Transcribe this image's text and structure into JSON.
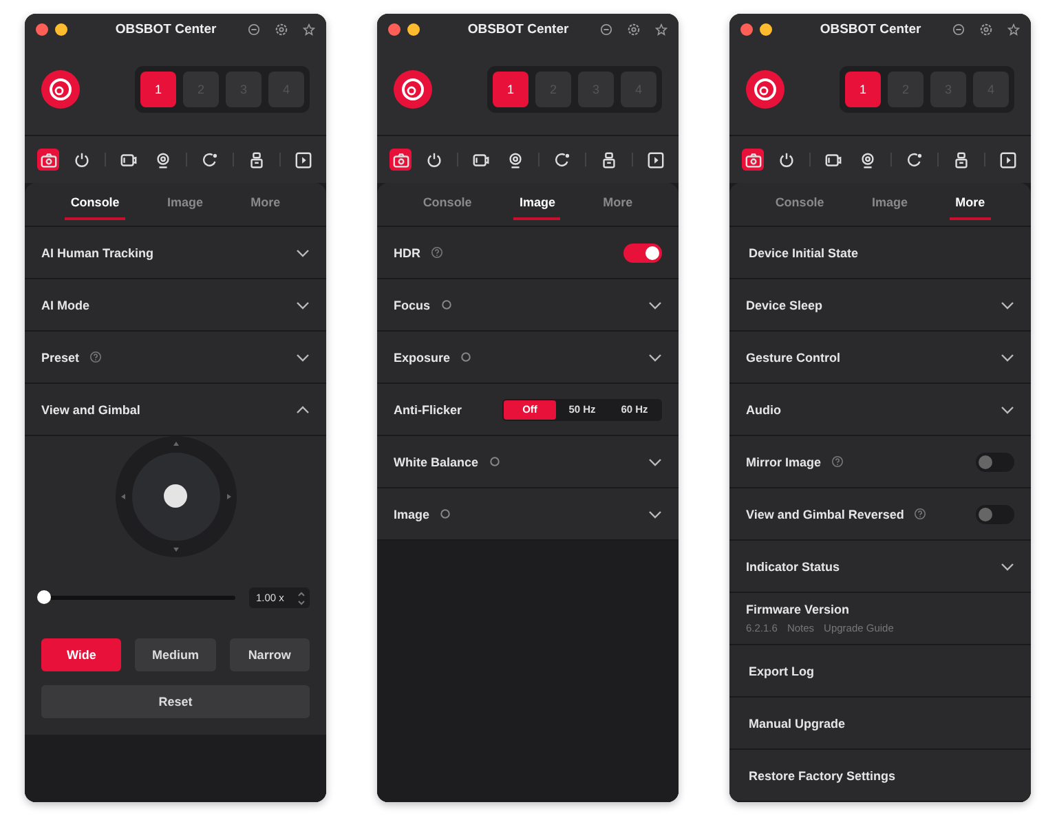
{
  "windows": [
    {
      "title": "OBSBOT Center",
      "devices": [
        {
          "label": "1",
          "selected": true
        },
        {
          "label": "2",
          "selected": false
        },
        {
          "label": "3",
          "selected": false
        },
        {
          "label": "4",
          "selected": false
        }
      ],
      "tools": [
        {
          "kind": "camera",
          "selected": true
        },
        {
          "kind": "power",
          "selected": false
        },
        {
          "kind": "sep"
        },
        {
          "kind": "recorder",
          "selected": false
        },
        {
          "kind": "webcam",
          "selected": false
        },
        {
          "kind": "sep"
        },
        {
          "kind": "rotate",
          "selected": false
        },
        {
          "kind": "sep"
        },
        {
          "kind": "usb",
          "selected": false
        },
        {
          "kind": "sep"
        },
        {
          "kind": "play",
          "selected": false
        }
      ],
      "tabs": [
        {
          "label": "Console",
          "selected": true
        },
        {
          "label": "Image",
          "selected": false
        },
        {
          "label": "More",
          "selected": false
        }
      ],
      "rows": [
        {
          "kind": "expand",
          "label": "AI Human Tracking",
          "expanded": false
        },
        {
          "kind": "expand",
          "label": "AI Mode",
          "expanded": false
        },
        {
          "kind": "expand",
          "label": "Preset",
          "help": true,
          "expanded": false
        },
        {
          "kind": "expand",
          "label": "View and Gimbal",
          "expanded": true,
          "gimbal": {
            "level": 0,
            "zoom_value": "1.00 x",
            "fov": [
              {
                "label": "Wide",
                "selected": true
              },
              {
                "label": "Medium",
                "selected": false
              },
              {
                "label": "Narrow",
                "selected": false
              }
            ],
            "reset": "Reset"
          }
        }
      ]
    },
    {
      "title": "OBSBOT Center",
      "devices": [
        {
          "label": "1",
          "selected": true
        },
        {
          "label": "2",
          "selected": false
        },
        {
          "label": "3",
          "selected": false
        },
        {
          "label": "4",
          "selected": false
        }
      ],
      "tools": [
        {
          "kind": "camera",
          "selected": true
        },
        {
          "kind": "power",
          "selected": false
        },
        {
          "kind": "sep"
        },
        {
          "kind": "recorder",
          "selected": false
        },
        {
          "kind": "webcam",
          "selected": false
        },
        {
          "kind": "sep"
        },
        {
          "kind": "rotate",
          "selected": false
        },
        {
          "kind": "sep"
        },
        {
          "kind": "usb",
          "selected": false
        },
        {
          "kind": "sep"
        },
        {
          "kind": "play",
          "selected": false
        }
      ],
      "tabs": [
        {
          "label": "Console",
          "selected": false
        },
        {
          "label": "Image",
          "selected": true
        },
        {
          "label": "More",
          "selected": false
        }
      ],
      "rows": [
        {
          "kind": "toggle",
          "label": "HDR",
          "help": true,
          "on": true
        },
        {
          "kind": "expand",
          "label": "Focus",
          "status": true,
          "expanded": false
        },
        {
          "kind": "expand",
          "label": "Exposure",
          "status": true,
          "expanded": false
        },
        {
          "kind": "segmented",
          "label": "Anti-Flicker",
          "options": [
            {
              "label": "Off",
              "selected": true
            },
            {
              "label": "50 Hz",
              "selected": false
            },
            {
              "label": "60 Hz",
              "selected": false
            }
          ]
        },
        {
          "kind": "expand",
          "label": "White Balance",
          "status": true,
          "expanded": false
        },
        {
          "kind": "expand",
          "label": "Image",
          "status": true,
          "expanded": false
        }
      ]
    },
    {
      "title": "OBSBOT Center",
      "devices": [
        {
          "label": "1",
          "selected": true
        },
        {
          "label": "2",
          "selected": false
        },
        {
          "label": "3",
          "selected": false
        },
        {
          "label": "4",
          "selected": false
        }
      ],
      "tools": [
        {
          "kind": "camera",
          "selected": true
        },
        {
          "kind": "power",
          "selected": false
        },
        {
          "kind": "sep"
        },
        {
          "kind": "recorder",
          "selected": false
        },
        {
          "kind": "webcam",
          "selected": false
        },
        {
          "kind": "sep"
        },
        {
          "kind": "rotate",
          "selected": false
        },
        {
          "kind": "sep"
        },
        {
          "kind": "usb",
          "selected": false
        },
        {
          "kind": "sep"
        },
        {
          "kind": "play",
          "selected": false
        }
      ],
      "tabs": [
        {
          "label": "Console",
          "selected": false
        },
        {
          "label": "Image",
          "selected": false
        },
        {
          "label": "More",
          "selected": true
        }
      ],
      "rows": [
        {
          "kind": "plain",
          "label": "Device Initial State"
        },
        {
          "kind": "expand",
          "label": "Device Sleep",
          "expanded": false
        },
        {
          "kind": "expand",
          "label": "Gesture Control",
          "expanded": false
        },
        {
          "kind": "expand",
          "label": "Audio",
          "expanded": false
        },
        {
          "kind": "toggle",
          "label": "Mirror Image",
          "help": true,
          "on": false
        },
        {
          "kind": "toggle",
          "label": "View and Gimbal Reversed",
          "help": true,
          "on": false
        },
        {
          "kind": "expand",
          "label": "Indicator Status",
          "expanded": false
        },
        {
          "kind": "firmware",
          "label": "Firmware Version",
          "version": "6.2.1.6",
          "links": [
            "Notes",
            "Upgrade Guide"
          ]
        },
        {
          "kind": "plain",
          "label": "Export Log"
        },
        {
          "kind": "plain",
          "label": "Manual Upgrade"
        },
        {
          "kind": "plain",
          "label": "Restore Factory Settings"
        }
      ]
    }
  ]
}
